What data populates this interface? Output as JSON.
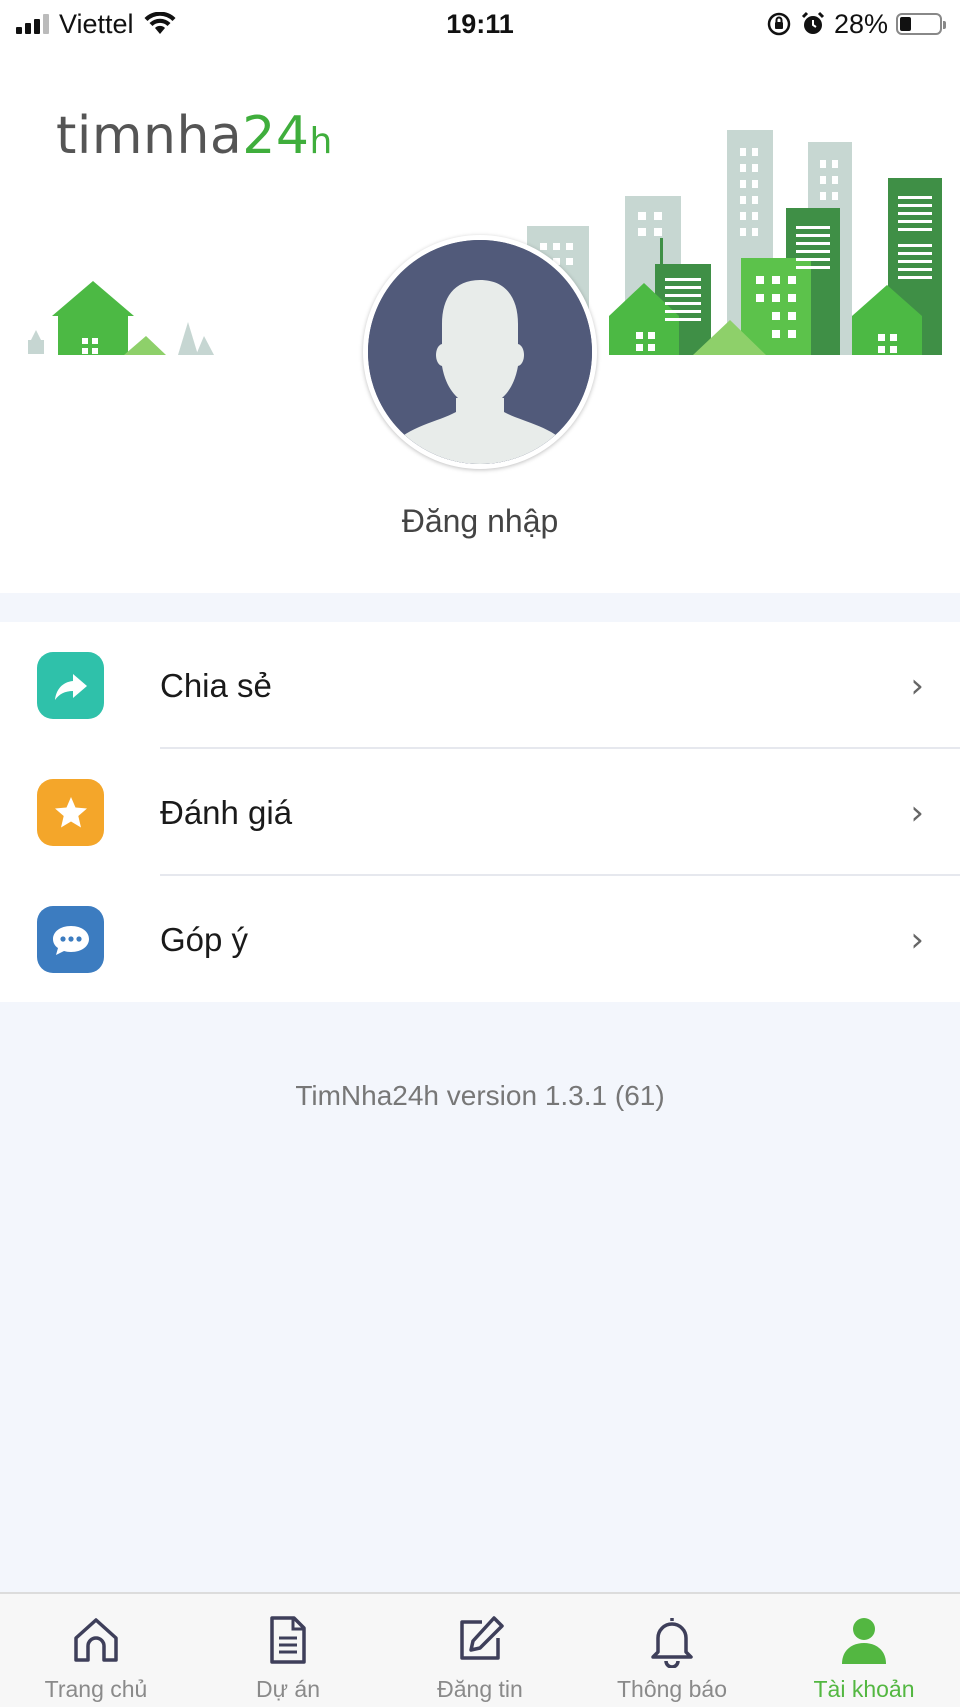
{
  "status_bar": {
    "carrier": "Viettel",
    "time": "19:11",
    "battery_percent": "28%",
    "battery_level": 0.28
  },
  "header": {
    "logo_part_dark": "tim",
    "logo_part_dark2": "nha",
    "logo_part_green": "24",
    "logo_part_small": "h",
    "login_label": "Đăng nhập"
  },
  "menu": {
    "items": [
      {
        "label": "Chia sẻ",
        "icon": "share-icon",
        "color": "#2fc1aa"
      },
      {
        "label": "Đánh giá",
        "icon": "star-icon",
        "color": "#f4a62a"
      },
      {
        "label": "Góp ý",
        "icon": "chat-icon",
        "color": "#3c7cc0"
      }
    ]
  },
  "version_text": "TimNha24h version 1.3.1 (61)",
  "tabbar": {
    "tabs": [
      {
        "label": "Trang chủ",
        "icon": "home-icon",
        "active": false
      },
      {
        "label": "Dự án",
        "icon": "document-icon",
        "active": false
      },
      {
        "label": "Đăng tin",
        "icon": "edit-icon",
        "active": false
      },
      {
        "label": "Thông báo",
        "icon": "bell-icon",
        "active": false
      },
      {
        "label": "Tài khoản",
        "icon": "user-icon",
        "active": true
      }
    ],
    "active_color": "#53b741",
    "inactive_color": "#3e3f5a"
  }
}
